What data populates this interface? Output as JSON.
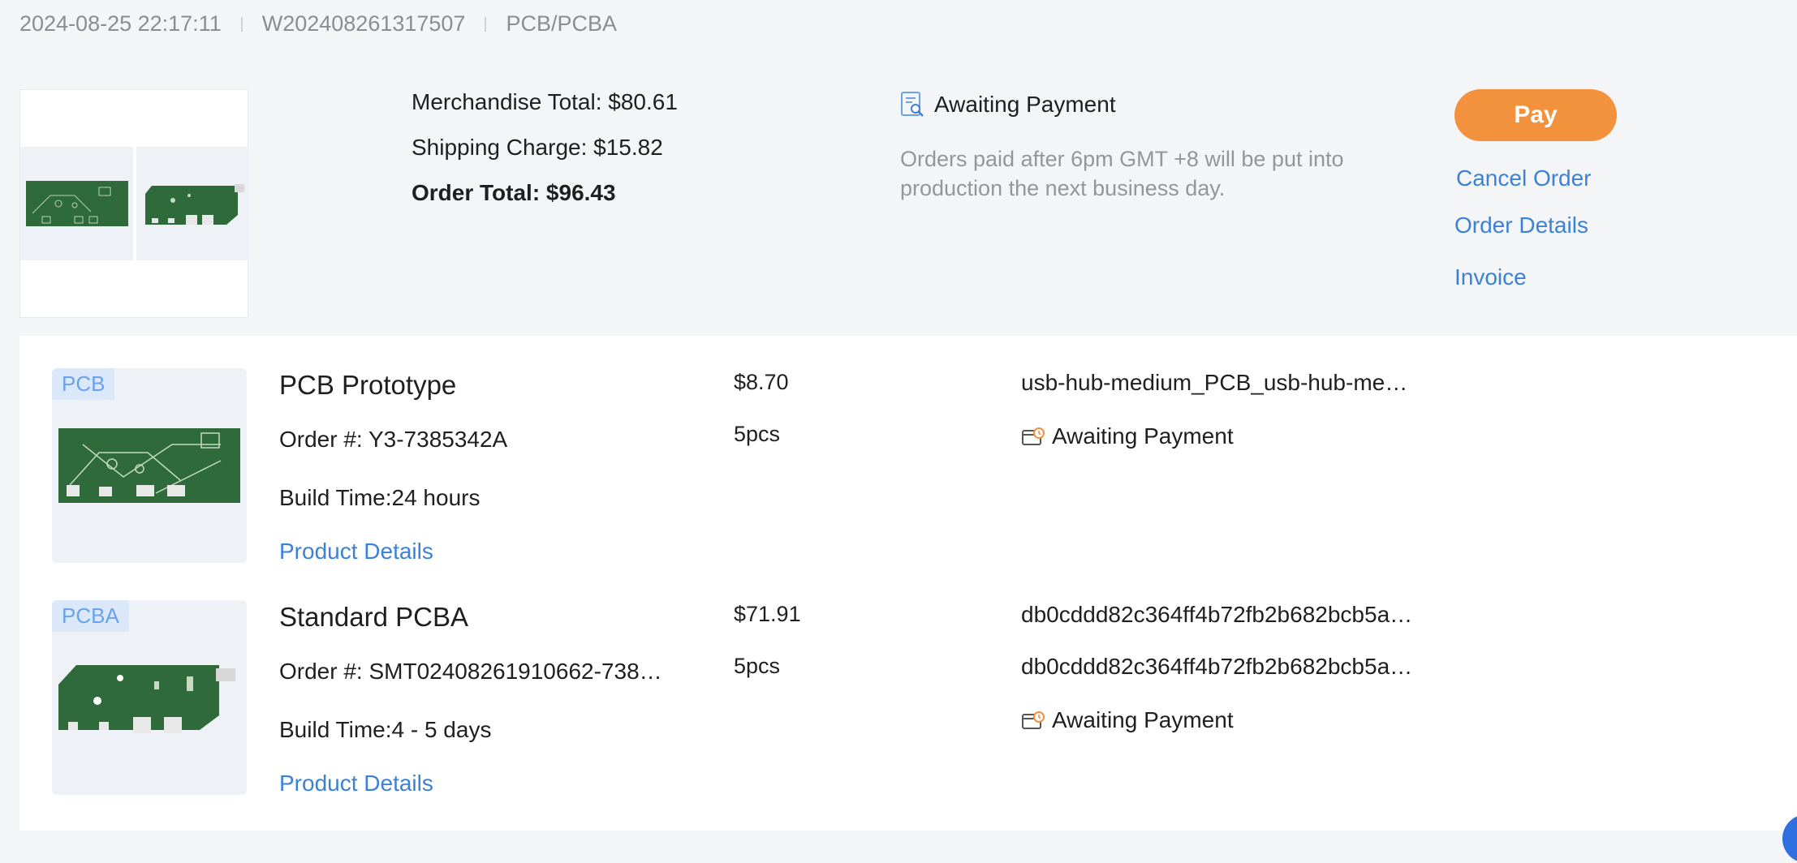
{
  "header": {
    "date": "2024-08-25 22:17:11",
    "order_no": "W202408261317507",
    "category": "PCB/PCBA"
  },
  "summary": {
    "merchandise_total": "Merchandise Total: $80.61",
    "shipping_charge": "Shipping Charge: $15.82",
    "order_total": "Order Total: $96.43",
    "status": "Awaiting Payment",
    "status_icon": "search-document-icon",
    "note": "Orders paid after 6pm GMT +8 will be put into production the next business day.",
    "pay_label": "Pay",
    "cancel_label": "Cancel Order",
    "details_label": "Order Details",
    "invoice_label": "Invoice"
  },
  "items": [
    {
      "tag": "PCB",
      "title": "PCB Prototype",
      "order": "Order #: Y3-7385342A",
      "build": "Build Time:24 hours",
      "link": "Product Details",
      "price": "$8.70",
      "qty": "5pcs",
      "file": "usb-hub-medium_PCB_usb-hub-me…",
      "status": "Awaiting Payment"
    },
    {
      "tag": "PCBA",
      "title": "Standard PCBA",
      "order": "Order #: SMT02408261910662-738…",
      "build": "Build Time:4 - 5 days",
      "link": "Product Details",
      "price": "$71.91",
      "qty": "5pcs",
      "file": "db0cddd82c364ff4b72fb2b682bcb5a…",
      "file2": "db0cddd82c364ff4b72fb2b682bcb5a…",
      "status": "Awaiting Payment"
    }
  ],
  "colors": {
    "accent_link": "#3b82d6",
    "pay_button": "#f2923d",
    "pcb_green": "#2f6b3a",
    "muted_text": "#8a8d93"
  }
}
